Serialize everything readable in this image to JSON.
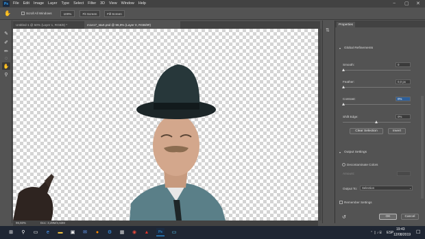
{
  "menubar": {
    "logo": "Ps",
    "items": [
      "File",
      "Edit",
      "Image",
      "Layer",
      "Type",
      "Select",
      "Filter",
      "3D",
      "View",
      "Window",
      "Help"
    ],
    "window_controls": [
      "−",
      "▢",
      "✕"
    ]
  },
  "options": {
    "scroll_all_windows": "Scroll All Windows",
    "zoom_100": "100%",
    "fit_screen": "Fit Screen",
    "fill_screen": "Fill Screen"
  },
  "tabs": [
    {
      "label": "Untitled-1 @ 50% (Layer 1, RGB/8) *"
    },
    {
      "label": "m1e17_start.psd @ 96,9% (Layer 0, RGB/8#)"
    }
  ],
  "status": {
    "zoom": "96,93%",
    "doc": "Doc: 3,49M/4,63M"
  },
  "properties": {
    "tab": "Properties",
    "global_refinements": "Global Refinements",
    "smooth_label": "Smooth:",
    "smooth_value": "0",
    "feather_label": "Feather:",
    "feather_value": "0,0 px",
    "contrast_label": "Contrast:",
    "contrast_value": "0%",
    "shift_edge_label": "Shift Edge:",
    "shift_edge_value": "0%",
    "clear_selection": "Clear Selection",
    "invert": "Invert",
    "output_settings": "Output Settings",
    "decontaminate": "Decontaminate Colors",
    "amount_label": "Amount:",
    "output_to_label": "Output To:",
    "output_to_value": "Selection",
    "remember": "Remember Settings",
    "ok": "OK",
    "cancel": "Cancel"
  },
  "taskbar": {
    "time": "19:43",
    "date": "12/08/2019",
    "lang": "ESP"
  }
}
